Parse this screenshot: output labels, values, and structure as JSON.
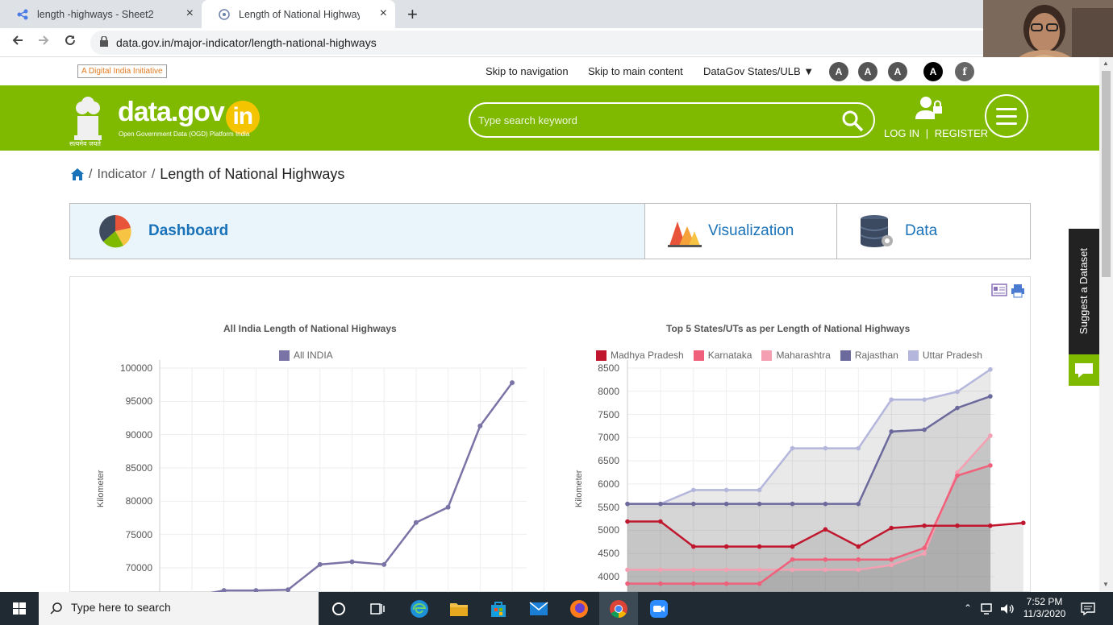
{
  "browser": {
    "tabs": [
      {
        "label": "length -highways - Sheet2",
        "close": "×"
      },
      {
        "label": "Length of National Highways | O",
        "close": "×"
      }
    ],
    "new_tab": "+",
    "url": "data.gov.in/major-indicator/length-national-highways"
  },
  "utility": {
    "digital_india": "A Digital India Initiative",
    "skip_nav": "Skip to navigation",
    "skip_main": "Skip to main content",
    "states_dropdown": "DataGov States/ULB",
    "font_buttons": [
      "A",
      "A",
      "A"
    ],
    "contrast_button": "A"
  },
  "header": {
    "logo_main": "data.gov",
    "logo_in": "in",
    "logo_sub": "Open Government Data (OGD) Platform India",
    "emblem_caption": "सत्यमेव जयते",
    "search_placeholder": "Type search keyword",
    "login": "LOG IN",
    "separator": "|",
    "register": "REGISTER"
  },
  "breadcrumb": {
    "separator": "/",
    "indicator": "Indicator",
    "current": "Length of National Highways"
  },
  "page_tabs": {
    "dashboard": "Dashboard",
    "visualization": "Visualization",
    "data": "Data"
  },
  "suggest_dataset": "Suggest a Dataset",
  "chart_data": [
    {
      "type": "line",
      "title": "All India Length of National Highways",
      "ylabel": "Kilometer",
      "ylim": [
        70000,
        100000
      ],
      "yticks": [
        100000,
        95000,
        90000,
        85000,
        80000,
        75000,
        70000
      ],
      "series": [
        {
          "name": "All INDIA",
          "color": "#7a74a6",
          "values": [
            65700,
            66600,
            66600,
            66700,
            70500,
            70900,
            70500,
            76800,
            79100,
            91300,
            97800
          ]
        }
      ]
    },
    {
      "type": "area",
      "title": "Top 5 States/UTs as per Length of National Highways",
      "ylabel": "Kilometer",
      "ylim": [
        4000,
        8500
      ],
      "yticks": [
        8500,
        8000,
        7500,
        7000,
        6500,
        6000,
        5500,
        5000,
        4500,
        4000
      ],
      "series": [
        {
          "name": "Madhya Pradesh",
          "color": "#c0172e",
          "values": [
            5190,
            5190,
            4650,
            4650,
            4650,
            4650,
            5020,
            4650,
            5050,
            5100,
            5100,
            5100,
            5160
          ]
        },
        {
          "name": "Karnataka",
          "color": "#f0607a",
          "values": [
            3850,
            3850,
            3850,
            3850,
            3850,
            4370,
            4370,
            4370,
            4370,
            4620,
            6180,
            6400
          ]
        },
        {
          "name": "Maharashtra",
          "color": "#f4a0b2",
          "values": [
            4150,
            4150,
            4150,
            4150,
            4150,
            4150,
            4150,
            4150,
            4250,
            4500,
            6250,
            7040
          ]
        },
        {
          "name": "Rajasthan",
          "color": "#6c6a9c",
          "values": [
            5570,
            5570,
            5570,
            5570,
            5570,
            5570,
            5570,
            5570,
            7130,
            7170,
            7640,
            7890
          ]
        },
        {
          "name": "Uttar Pradesh",
          "color": "#b4b6dc",
          "values": [
            5570,
            5570,
            5870,
            5870,
            5870,
            6770,
            6770,
            6770,
            7820,
            7820,
            7990,
            8470
          ]
        }
      ]
    }
  ],
  "taskbar": {
    "search_placeholder": "Type here to search",
    "time": "7:52 PM",
    "date": "11/3/2020"
  }
}
